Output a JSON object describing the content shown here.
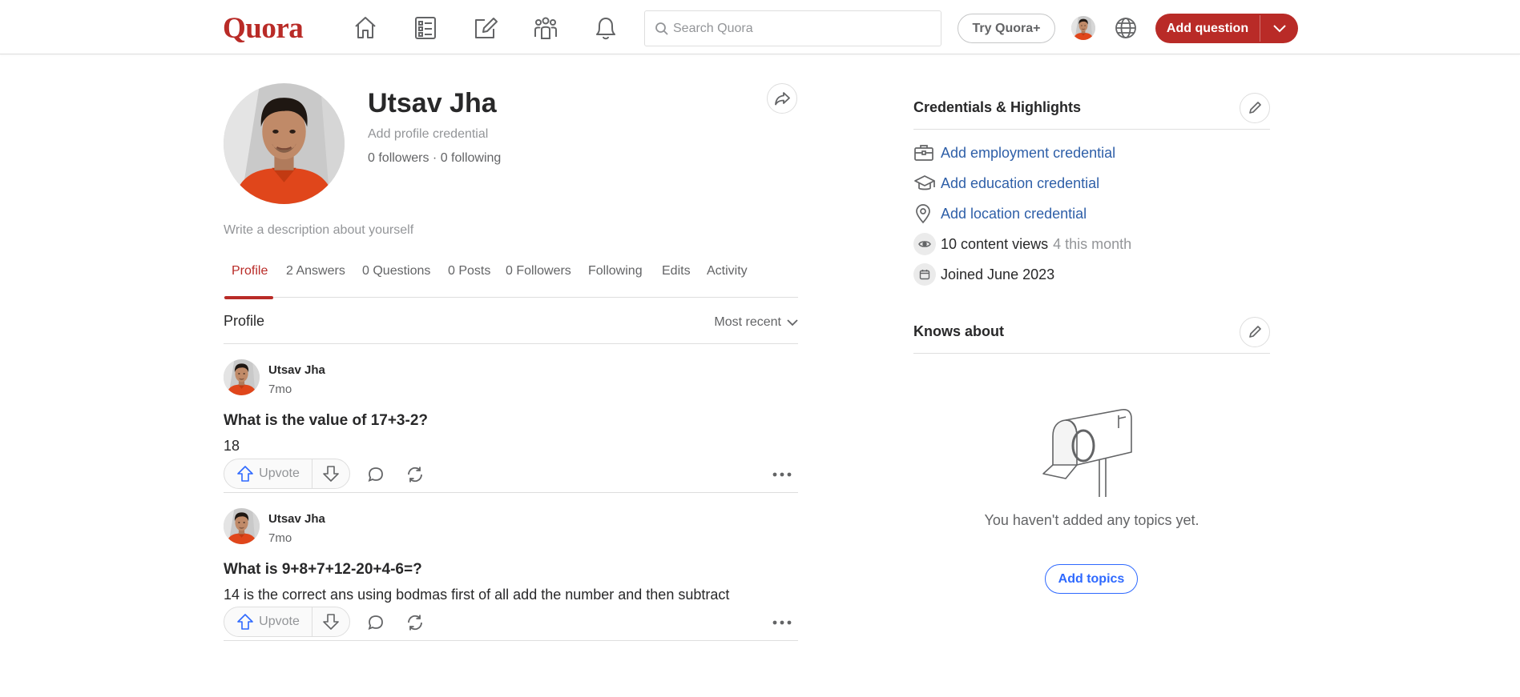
{
  "header": {
    "logo": "Quora",
    "search_placeholder": "Search Quora",
    "try_plus": "Try Quora+",
    "add_question": "Add question",
    "nav_icons": [
      "home-icon",
      "following-icon",
      "answer-icon",
      "spaces-icon",
      "notifications-icon"
    ]
  },
  "profile": {
    "name": "Utsav Jha",
    "credential": "Add profile credential",
    "follows": "0 followers · 0 following",
    "description": "Write a description about yourself"
  },
  "tabs": [
    "Profile",
    "2 Answers",
    "0 Questions",
    "0 Posts",
    "0 Followers",
    "Following",
    "Edits",
    "Activity"
  ],
  "feed": {
    "title": "Profile",
    "sort": "Most recent",
    "posts": [
      {
        "author": "Utsav Jha",
        "time": "7mo",
        "question": "What is the value of 17+3-2?",
        "answer": "18",
        "upvote": "Upvote"
      },
      {
        "author": "Utsav Jha",
        "time": "7mo",
        "question": "What is 9+8+7+12-20+4-6=?",
        "answer": "14 is the correct ans using bodmas first of all add the number and then subtract",
        "upvote": "Upvote"
      }
    ]
  },
  "right": {
    "credentials_title": "Credentials & Highlights",
    "employment": "Add employment credential",
    "education": "Add education credential",
    "location": "Add location credential",
    "views": "10 content views",
    "views_month": "4 this month",
    "joined": "Joined June 2023",
    "knows_title": "Knows about",
    "empty": "You haven't added any topics yet.",
    "add_topics": "Add topics"
  },
  "colors": {
    "brand": "#b92b27",
    "link": "#2e69ff"
  }
}
